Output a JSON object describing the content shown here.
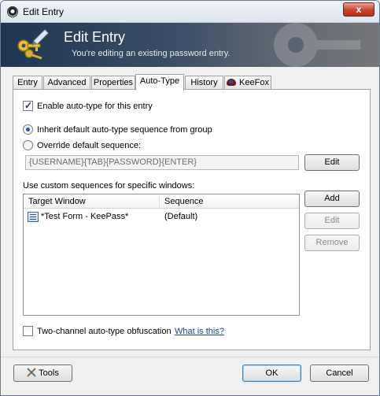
{
  "window": {
    "title": "Edit Entry",
    "close_glyph": "x"
  },
  "banner": {
    "title": "Edit Entry",
    "subtitle": "You're editing an existing password entry."
  },
  "tabs": [
    {
      "label": "Entry"
    },
    {
      "label": "Advanced"
    },
    {
      "label": "Properties"
    },
    {
      "label": "Auto-Type",
      "active": true
    },
    {
      "label": "History"
    },
    {
      "label": "KeeFox"
    }
  ],
  "autotype": {
    "enable_label": "Enable auto-type for this entry",
    "enable_checked": true,
    "inherit_label": "Inherit default auto-type sequence from group",
    "override_label": "Override default sequence:",
    "selected_option": "inherit",
    "sequence_value": "{USERNAME}{TAB}{PASSWORD}{ENTER}",
    "edit_label": "Edit",
    "custom_label": "Use custom sequences for specific windows:",
    "columns": [
      "Target Window",
      "Sequence"
    ],
    "rows": [
      {
        "target": "*Test Form - KeePass*",
        "sequence": "(Default)"
      }
    ],
    "add_label": "Add",
    "edit2_label": "Edit",
    "remove_label": "Remove",
    "obfuscation_label": "Two-channel auto-type obfuscation",
    "obfuscation_checked": false,
    "whatis_label": "What is this?"
  },
  "footer": {
    "tools_label": "Tools",
    "ok_label": "OK",
    "cancel_label": "Cancel"
  },
  "colors": {
    "banner_dark": "#1e3652",
    "link": "#1a3fa8",
    "close_red": "#c6412d"
  }
}
